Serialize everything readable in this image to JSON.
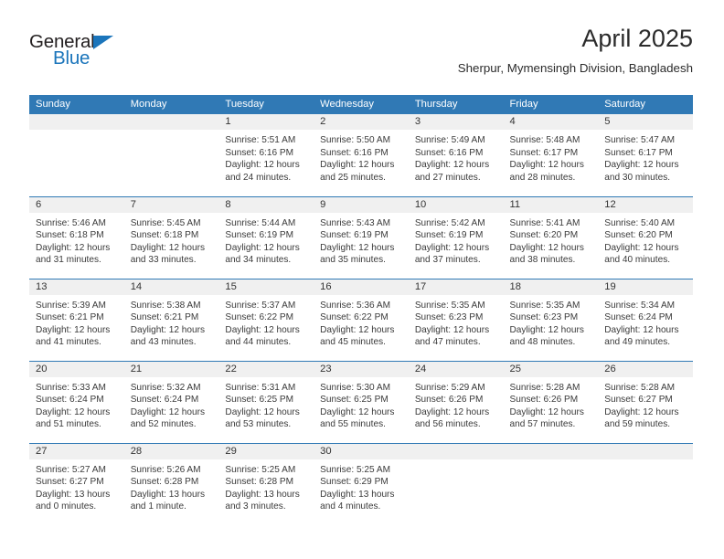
{
  "logo": {
    "word_one": "General",
    "word_two": "Blue",
    "triangle_color": "#1b75bb",
    "text_color": "#231f20"
  },
  "header": {
    "title": "April 2025",
    "subtitle": "Sherpur, Mymensingh Division, Bangladesh"
  },
  "theme": {
    "header_blue": "#3079b5",
    "row_border_blue": "#3079b5",
    "daynum_band": "#f0f0f0",
    "text": "#3a3a3a"
  },
  "weekday_headers": [
    "Sunday",
    "Monday",
    "Tuesday",
    "Wednesday",
    "Thursday",
    "Friday",
    "Saturday"
  ],
  "labels": {
    "sunrise_prefix": "Sunrise:",
    "sunset_prefix": "Sunset:",
    "daylight_prefix": "Daylight:"
  },
  "weeks": [
    [
      {
        "day": "",
        "empty": true
      },
      {
        "day": "",
        "empty": true
      },
      {
        "day": "1",
        "sunrise": "Sunrise: 5:51 AM",
        "sunset": "Sunset: 6:16 PM",
        "daylight_line1": "Daylight: 12 hours",
        "daylight_line2": "and 24 minutes."
      },
      {
        "day": "2",
        "sunrise": "Sunrise: 5:50 AM",
        "sunset": "Sunset: 6:16 PM",
        "daylight_line1": "Daylight: 12 hours",
        "daylight_line2": "and 25 minutes."
      },
      {
        "day": "3",
        "sunrise": "Sunrise: 5:49 AM",
        "sunset": "Sunset: 6:16 PM",
        "daylight_line1": "Daylight: 12 hours",
        "daylight_line2": "and 27 minutes."
      },
      {
        "day": "4",
        "sunrise": "Sunrise: 5:48 AM",
        "sunset": "Sunset: 6:17 PM",
        "daylight_line1": "Daylight: 12 hours",
        "daylight_line2": "and 28 minutes."
      },
      {
        "day": "5",
        "sunrise": "Sunrise: 5:47 AM",
        "sunset": "Sunset: 6:17 PM",
        "daylight_line1": "Daylight: 12 hours",
        "daylight_line2": "and 30 minutes."
      }
    ],
    [
      {
        "day": "6",
        "sunrise": "Sunrise: 5:46 AM",
        "sunset": "Sunset: 6:18 PM",
        "daylight_line1": "Daylight: 12 hours",
        "daylight_line2": "and 31 minutes."
      },
      {
        "day": "7",
        "sunrise": "Sunrise: 5:45 AM",
        "sunset": "Sunset: 6:18 PM",
        "daylight_line1": "Daylight: 12 hours",
        "daylight_line2": "and 33 minutes."
      },
      {
        "day": "8",
        "sunrise": "Sunrise: 5:44 AM",
        "sunset": "Sunset: 6:19 PM",
        "daylight_line1": "Daylight: 12 hours",
        "daylight_line2": "and 34 minutes."
      },
      {
        "day": "9",
        "sunrise": "Sunrise: 5:43 AM",
        "sunset": "Sunset: 6:19 PM",
        "daylight_line1": "Daylight: 12 hours",
        "daylight_line2": "and 35 minutes."
      },
      {
        "day": "10",
        "sunrise": "Sunrise: 5:42 AM",
        "sunset": "Sunset: 6:19 PM",
        "daylight_line1": "Daylight: 12 hours",
        "daylight_line2": "and 37 minutes."
      },
      {
        "day": "11",
        "sunrise": "Sunrise: 5:41 AM",
        "sunset": "Sunset: 6:20 PM",
        "daylight_line1": "Daylight: 12 hours",
        "daylight_line2": "and 38 minutes."
      },
      {
        "day": "12",
        "sunrise": "Sunrise: 5:40 AM",
        "sunset": "Sunset: 6:20 PM",
        "daylight_line1": "Daylight: 12 hours",
        "daylight_line2": "and 40 minutes."
      }
    ],
    [
      {
        "day": "13",
        "sunrise": "Sunrise: 5:39 AM",
        "sunset": "Sunset: 6:21 PM",
        "daylight_line1": "Daylight: 12 hours",
        "daylight_line2": "and 41 minutes."
      },
      {
        "day": "14",
        "sunrise": "Sunrise: 5:38 AM",
        "sunset": "Sunset: 6:21 PM",
        "daylight_line1": "Daylight: 12 hours",
        "daylight_line2": "and 43 minutes."
      },
      {
        "day": "15",
        "sunrise": "Sunrise: 5:37 AM",
        "sunset": "Sunset: 6:22 PM",
        "daylight_line1": "Daylight: 12 hours",
        "daylight_line2": "and 44 minutes."
      },
      {
        "day": "16",
        "sunrise": "Sunrise: 5:36 AM",
        "sunset": "Sunset: 6:22 PM",
        "daylight_line1": "Daylight: 12 hours",
        "daylight_line2": "and 45 minutes."
      },
      {
        "day": "17",
        "sunrise": "Sunrise: 5:35 AM",
        "sunset": "Sunset: 6:23 PM",
        "daylight_line1": "Daylight: 12 hours",
        "daylight_line2": "and 47 minutes."
      },
      {
        "day": "18",
        "sunrise": "Sunrise: 5:35 AM",
        "sunset": "Sunset: 6:23 PM",
        "daylight_line1": "Daylight: 12 hours",
        "daylight_line2": "and 48 minutes."
      },
      {
        "day": "19",
        "sunrise": "Sunrise: 5:34 AM",
        "sunset": "Sunset: 6:24 PM",
        "daylight_line1": "Daylight: 12 hours",
        "daylight_line2": "and 49 minutes."
      }
    ],
    [
      {
        "day": "20",
        "sunrise": "Sunrise: 5:33 AM",
        "sunset": "Sunset: 6:24 PM",
        "daylight_line1": "Daylight: 12 hours",
        "daylight_line2": "and 51 minutes."
      },
      {
        "day": "21",
        "sunrise": "Sunrise: 5:32 AM",
        "sunset": "Sunset: 6:24 PM",
        "daylight_line1": "Daylight: 12 hours",
        "daylight_line2": "and 52 minutes."
      },
      {
        "day": "22",
        "sunrise": "Sunrise: 5:31 AM",
        "sunset": "Sunset: 6:25 PM",
        "daylight_line1": "Daylight: 12 hours",
        "daylight_line2": "and 53 minutes."
      },
      {
        "day": "23",
        "sunrise": "Sunrise: 5:30 AM",
        "sunset": "Sunset: 6:25 PM",
        "daylight_line1": "Daylight: 12 hours",
        "daylight_line2": "and 55 minutes."
      },
      {
        "day": "24",
        "sunrise": "Sunrise: 5:29 AM",
        "sunset": "Sunset: 6:26 PM",
        "daylight_line1": "Daylight: 12 hours",
        "daylight_line2": "and 56 minutes."
      },
      {
        "day": "25",
        "sunrise": "Sunrise: 5:28 AM",
        "sunset": "Sunset: 6:26 PM",
        "daylight_line1": "Daylight: 12 hours",
        "daylight_line2": "and 57 minutes."
      },
      {
        "day": "26",
        "sunrise": "Sunrise: 5:28 AM",
        "sunset": "Sunset: 6:27 PM",
        "daylight_line1": "Daylight: 12 hours",
        "daylight_line2": "and 59 minutes."
      }
    ],
    [
      {
        "day": "27",
        "sunrise": "Sunrise: 5:27 AM",
        "sunset": "Sunset: 6:27 PM",
        "daylight_line1": "Daylight: 13 hours",
        "daylight_line2": "and 0 minutes."
      },
      {
        "day": "28",
        "sunrise": "Sunrise: 5:26 AM",
        "sunset": "Sunset: 6:28 PM",
        "daylight_line1": "Daylight: 13 hours",
        "daylight_line2": "and 1 minute."
      },
      {
        "day": "29",
        "sunrise": "Sunrise: 5:25 AM",
        "sunset": "Sunset: 6:28 PM",
        "daylight_line1": "Daylight: 13 hours",
        "daylight_line2": "and 3 minutes."
      },
      {
        "day": "30",
        "sunrise": "Sunrise: 5:25 AM",
        "sunset": "Sunset: 6:29 PM",
        "daylight_line1": "Daylight: 13 hours",
        "daylight_line2": "and 4 minutes."
      },
      {
        "day": "",
        "empty": true
      },
      {
        "day": "",
        "empty": true
      },
      {
        "day": "",
        "empty": true
      }
    ]
  ]
}
